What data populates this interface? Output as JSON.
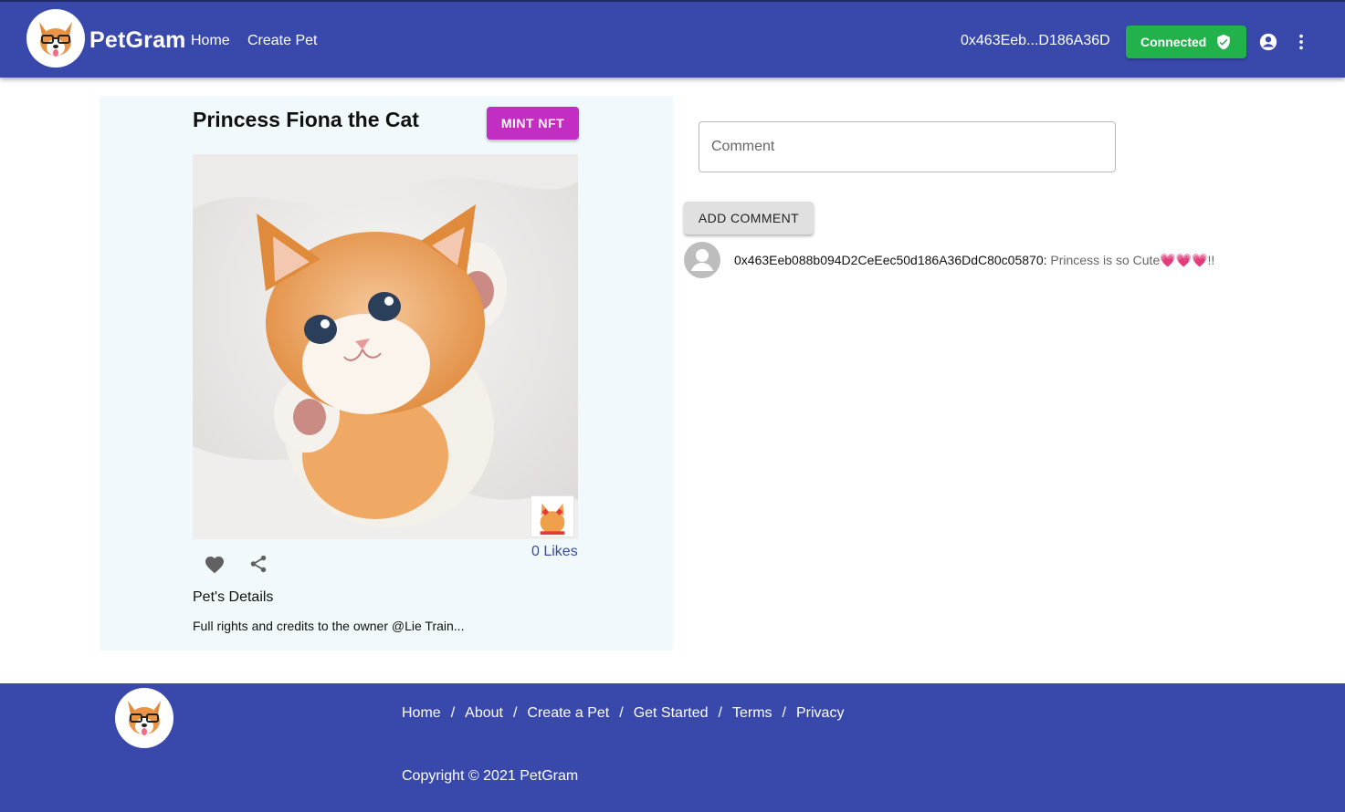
{
  "header": {
    "brand": "PetGram",
    "nav": {
      "home": "Home",
      "create_pet": "Create Pet"
    },
    "wallet_address": "0x463Eeb...D186A36D",
    "connected_label": "Connected",
    "icons": [
      "dog-logo-icon",
      "shield-check-icon",
      "account-circle-icon",
      "more-vert-icon"
    ]
  },
  "pet": {
    "title": "Princess Fiona the Cat",
    "mint_label": "MINT NFT",
    "likes_label": "0 Likes",
    "details_heading": "Pet's Details",
    "details_text": "Full rights and credits to the owner @Lie Train..."
  },
  "comments": {
    "placeholder": "Comment",
    "add_label": "ADD COMMENT",
    "items": [
      {
        "author": "0x463Eeb088b094D2CeEec50d186A36DdC80c05870:",
        "text": "Princess is so Cute💗💗💗!!"
      }
    ]
  },
  "footer": {
    "links": [
      "Home",
      "About",
      "Create a Pet",
      "Get Started",
      "Terms",
      "Privacy"
    ],
    "separator": "/",
    "copyright": "Copyright © 2021 PetGram"
  },
  "colors": {
    "primary": "#3949ab",
    "connected": "#22b24c",
    "mint": "#c22ec2",
    "card_bg": "#f1f9fc"
  }
}
